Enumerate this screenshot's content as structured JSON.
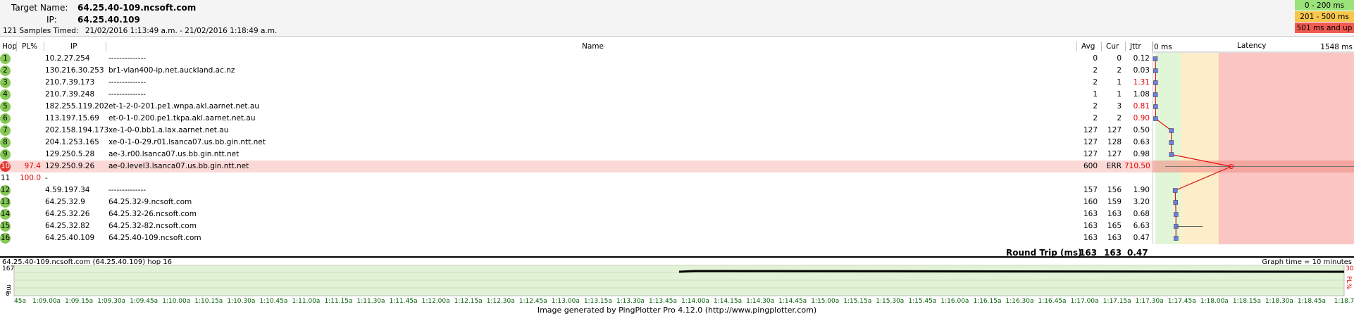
{
  "header": {
    "target_label": "Target Name:",
    "target_value": "64.25.40-109.ncsoft.com",
    "ip_label": "IP:",
    "ip_value": "64.25.40.109",
    "samples_text": "121 Samples Timed:",
    "samples_range": "21/02/2016 1:13:49 a.m. - 21/02/2016 1:18:49 a.m."
  },
  "legend": [
    {
      "label": "0 - 200 ms",
      "color": "#9be27a"
    },
    {
      "label": "201 - 500 ms",
      "color": "#f7c64d"
    },
    {
      "label": "501 ms and up",
      "color": "#f05a50"
    }
  ],
  "columns": {
    "hop": "Hop",
    "pl": "PL%",
    "ip": "IP",
    "name": "Name",
    "avg": "Avg",
    "cur": "Cur",
    "jttr": "Jttr",
    "lat_min": "0 ms",
    "lat_title": "Latency",
    "lat_max": "1548 ms"
  },
  "hops": [
    {
      "hop": "1",
      "pl": "",
      "ip": "10.2.27.254",
      "name": "--------------",
      "avg": "0",
      "cur": "0",
      "jttr": "0.12",
      "jred": false,
      "status": "green",
      "lat": 0
    },
    {
      "hop": "2",
      "pl": "",
      "ip": "130.216.30.253",
      "name": "br1-vlan400-ip.net.auckland.ac.nz",
      "avg": "2",
      "cur": "2",
      "jttr": "0.03",
      "jred": false,
      "status": "green",
      "lat": 2
    },
    {
      "hop": "3",
      "pl": "",
      "ip": "210.7.39.173",
      "name": "--------------",
      "avg": "2",
      "cur": "1",
      "jttr": "1.31",
      "jred": true,
      "status": "green",
      "lat": 2
    },
    {
      "hop": "4",
      "pl": "",
      "ip": "210.7.39.248",
      "name": "--------------",
      "avg": "1",
      "cur": "1",
      "jttr": "1.08",
      "jred": false,
      "status": "green",
      "lat": 1
    },
    {
      "hop": "5",
      "pl": "",
      "ip": "182.255.119.202",
      "name": "et-1-2-0-201.pe1.wnpa.akl.aarnet.net.au",
      "avg": "2",
      "cur": "3",
      "jttr": "0.81",
      "jred": true,
      "status": "green",
      "lat": 2
    },
    {
      "hop": "6",
      "pl": "",
      "ip": "113.197.15.69",
      "name": "et-0-1-0.200.pe1.tkpa.akl.aarnet.net.au",
      "avg": "2",
      "cur": "2",
      "jttr": "0.90",
      "jred": true,
      "status": "green",
      "lat": 2
    },
    {
      "hop": "7",
      "pl": "",
      "ip": "202.158.194.173",
      "name": "xe-1-0-0.bb1.a.lax.aarnet.net.au",
      "avg": "127",
      "cur": "127",
      "jttr": "0.50",
      "jred": false,
      "status": "green",
      "lat": 127
    },
    {
      "hop": "8",
      "pl": "",
      "ip": "204.1.253.165",
      "name": "xe-0-1-0-29.r01.lsanca07.us.bb.gin.ntt.net",
      "avg": "127",
      "cur": "128",
      "jttr": "0.63",
      "jred": false,
      "status": "green",
      "lat": 127
    },
    {
      "hop": "9",
      "pl": "",
      "ip": "129.250.5.28",
      "name": "ae-3.r00.lsanca07.us.bb.gin.ntt.net",
      "avg": "127",
      "cur": "127",
      "jttr": "0.98",
      "jred": false,
      "status": "green",
      "lat": 127
    },
    {
      "hop": "10",
      "pl": "97.4",
      "ip": "129.250.9.26",
      "name": "ae-0.level3.lsanca07.us.bb.gin.ntt.net",
      "avg": "600",
      "cur": "ERR",
      "jttr": "710.50",
      "jred": true,
      "status": "red",
      "lat": 600
    },
    {
      "hop": "11",
      "pl": "100.0",
      "ip": "-",
      "name": "",
      "avg": "",
      "cur": "",
      "jttr": "",
      "jred": false,
      "status": "none",
      "lat": null
    },
    {
      "hop": "12",
      "pl": "",
      "ip": "4.59.197.34",
      "name": "--------------",
      "avg": "157",
      "cur": "156",
      "jttr": "1.90",
      "jred": false,
      "status": "green",
      "lat": 157
    },
    {
      "hop": "13",
      "pl": "",
      "ip": "64.25.32.9",
      "name": "64.25.32-9.ncsoft.com",
      "avg": "160",
      "cur": "159",
      "jttr": "3.20",
      "jred": false,
      "status": "green",
      "lat": 160
    },
    {
      "hop": "14",
      "pl": "",
      "ip": "64.25.32.26",
      "name": "64.25.32-26.ncsoft.com",
      "avg": "163",
      "cur": "163",
      "jttr": "0.68",
      "jred": false,
      "status": "green",
      "lat": 163
    },
    {
      "hop": "15",
      "pl": "",
      "ip": "64.25.32.82",
      "name": "64.25.32-82.ncsoft.com",
      "avg": "163",
      "cur": "165",
      "jttr": "6.63",
      "jred": false,
      "status": "green",
      "lat": 163
    },
    {
      "hop": "16",
      "pl": "",
      "ip": "64.25.40.109",
      "name": "64.25.40-109.ncsoft.com",
      "avg": "163",
      "cur": "163",
      "jttr": "0.47",
      "jred": false,
      "status": "green",
      "lat": 163
    }
  ],
  "latency_scale_max": 1548,
  "roundtrip": {
    "label": "Round Trip (ms)",
    "avg": "163",
    "cur": "163",
    "jttr": "0.47"
  },
  "bottom": {
    "title": "64.25.40-109.ncsoft.com (64.25.40.109) hop 16",
    "graph_time": "Graph time = 10 minutes",
    "y_max": "167",
    "y_min": "0",
    "y_unit": "ms",
    "pl_max": "30",
    "pl_unit": "PL%",
    "time_labels": [
      "45a",
      "1:09.00a",
      "1:09.15a",
      "1:09.30a",
      "1:09.45a",
      "1:10.00a",
      "1:10.15a",
      "1:10.30a",
      "1:10.45a",
      "1:11.00a",
      "1:11.15a",
      "1:11.30a",
      "1:11.45a",
      "1:12.00a",
      "1:12.15a",
      "1:12.30a",
      "1:12.45a",
      "1:13.00a",
      "1:13.15a",
      "1:13.30a",
      "1:13.45a",
      "1:14.00a",
      "1:14.15a",
      "1:14.30a",
      "1:14.45a",
      "1:15.00a",
      "1:15.15a",
      "1:15.30a",
      "1:15.45a",
      "1:16.00a",
      "1:16.15a",
      "1:16.30a",
      "1:16.45a",
      "1:17.00a",
      "1:17.15a",
      "1:17.30a",
      "1:17.45a",
      "1:18.00a",
      "1:18.15a",
      "1:18.30a",
      "1:18.45a",
      "1:18.7"
    ],
    "data_start_fraction": 0.5
  },
  "footer": "Image generated by PingPlotter Pro 4.12.0 (http://www.pingplotter.com)"
}
